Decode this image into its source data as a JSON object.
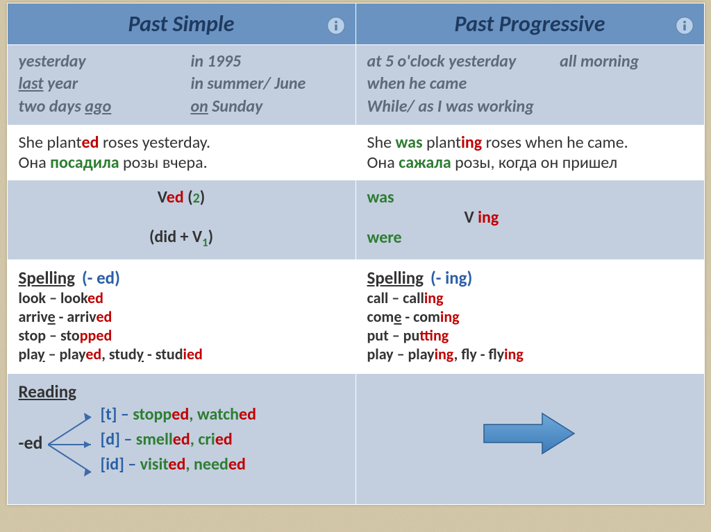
{
  "header": {
    "col1": "Past Simple",
    "col2": "Past Progressive"
  },
  "markers": {
    "simple": {
      "c1r1": "yesterday",
      "c2r1": "in 1995",
      "c1r2_a": "last",
      "c1r2_b": " year",
      "c2r2": "in summer/ June",
      "c1r3_a": "two days ",
      "c1r3_b": "ago",
      "c2r3_a": "on",
      "c2r3_b": " Sunday"
    },
    "prog": {
      "l1_a": "at 5 o'clock  yesterday",
      "l1_b": "all morning",
      "l2_a": "when ",
      "l2_b": "he came",
      "l3_a": "While/ as ",
      "l3_b": "I was working"
    }
  },
  "example": {
    "simple": {
      "en_a": "She  plant",
      "en_b": "ed",
      "en_c": " roses yesterday.",
      "ru_a": "Она ",
      "ru_b": "посадила",
      "ru_c": " розы вчера."
    },
    "prog": {
      "en_a": "She ",
      "en_b": "was",
      "en_c": " plant",
      "en_d": "ing",
      "en_e": " roses when he came.",
      "ru_a": "Она ",
      "ru_b": "сажала",
      "ru_c": " розы, когда он пришел"
    }
  },
  "formula": {
    "simple": {
      "l1_a": "V",
      "l1_b": "ed",
      "l1_c": " (",
      "l1_d": "2",
      "l1_e": ")",
      "l2_a": "(did + V",
      "l2_b": "1",
      "l2_c": ")"
    },
    "prog": {
      "was": "was",
      "mid_a": "V ",
      "mid_b": "ing",
      "were": "were"
    }
  },
  "spelling": {
    "simple": {
      "title_a": "Spelling",
      "title_b": "(- ed)",
      "r1_a": "look – look",
      "r1_b": "ed",
      "r2_a": "arriv",
      "r2_b": "e",
      "r2_c": " - arriv",
      "r2_d": "ed",
      "r3_a": "stop – sto",
      "r3_b": "pp",
      "r3_c": "ed",
      "r4_a": "pla",
      "r4_b": "y",
      "r4_c": " – play",
      "r4_d": "ed",
      "r4_e": ", stud",
      "r4_f": "y",
      "r4_g": " - stud",
      "r4_h": "i",
      "r4_i": "ed"
    },
    "prog": {
      "title_a": "Spelling",
      "title_b": "(- ing)",
      "r1_a": "call – call",
      "r1_b": "ing",
      "r2_a": "com",
      "r2_b": "e",
      "r2_c": " - com",
      "r2_d": "ing",
      "r3_a": "put – pu",
      "r3_b": "tt",
      "r3_c": "ing",
      "r4_a": "play – play",
      "r4_b": "ing",
      "r4_c": ", fly - fly",
      "r4_d": "ing"
    }
  },
  "reading": {
    "title": "Reading",
    "ed": "-ed",
    "t_a": "[t] – ",
    "t_b": "stopp",
    "t_c": "ed",
    "t_d": ", watch",
    "t_e": "ed",
    "d_a": "[d] – ",
    "d_b": "smell",
    "d_c": "ed",
    "d_d": ", cri",
    "d_e": "ed",
    "id_a": "[id] – ",
    "id_b": "visit",
    "id_c": "ed",
    "id_d": ", need",
    "id_e": "ed"
  }
}
